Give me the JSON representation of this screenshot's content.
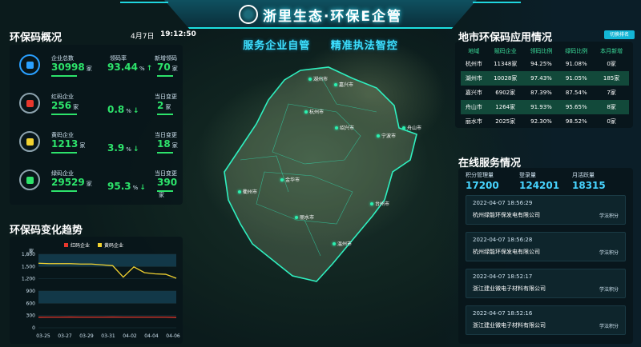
{
  "header": {
    "title": "浙里生态·环保E企管",
    "slogan_left": "服务企业自管",
    "slogan_right": "精准执法智控"
  },
  "overview": {
    "title": "环保码概况",
    "date": "4月7日",
    "time": "19:12:50",
    "rows": [
      {
        "label1": "企业总数",
        "value1": "30998",
        "unit1": "家",
        "label2": "领码率",
        "value2": "93.44",
        "unit2": "%",
        "label3": "新增领码",
        "value3": "70",
        "unit3": "家",
        "color": "#2de36b",
        "icon": "enterprise-icon"
      },
      {
        "label1": "红码企业",
        "value1": "256",
        "unit1": "家",
        "label2": "",
        "value2": "0.8",
        "unit2": "%",
        "label3": "当日变更",
        "value3": "2",
        "unit3": "家",
        "color": "#2de36b",
        "icon": "red-code-icon"
      },
      {
        "label1": "黄码企业",
        "value1": "1213",
        "unit1": "家",
        "label2": "",
        "value2": "3.9",
        "unit2": "%",
        "label3": "当日变更",
        "value3": "18",
        "unit3": "家",
        "color": "#2de36b",
        "icon": "yellow-code-icon"
      },
      {
        "label1": "绿码企业",
        "value1": "29529",
        "unit1": "家",
        "label2": "",
        "value2": "95.3",
        "unit2": "%",
        "label3": "当日变更",
        "value3": "390",
        "unit3": "家",
        "color": "#2de36b",
        "icon": "green-code-icon"
      }
    ]
  },
  "trend": {
    "title": "环保码变化趋势"
  },
  "chart_data": {
    "type": "line",
    "title": "",
    "ylabel": "家",
    "xlabel": "",
    "ylim": [
      0,
      1800
    ],
    "yticks": [
      "1,800",
      "1,500",
      "1,200",
      "900",
      "600",
      "300",
      "0"
    ],
    "x": [
      "03-25",
      "03-27",
      "03-29",
      "03-31",
      "04-02",
      "04-04",
      "04-06"
    ],
    "series": [
      {
        "name": "红码企业",
        "color": "#e8372c",
        "values": [
          260,
          262,
          262,
          263,
          262,
          262,
          262,
          263,
          262,
          262,
          262,
          262,
          262,
          256
        ]
      },
      {
        "name": "黄码企业",
        "color": "#f2d230",
        "values": [
          1580,
          1570,
          1570,
          1570,
          1560,
          1560,
          1540,
          1520,
          1240,
          1490,
          1350,
          1320,
          1310,
          1213
        ]
      }
    ],
    "x_points": 14,
    "grid": true,
    "legend": "top-left"
  },
  "cities": {
    "title": "地市环保码应用情况",
    "button": "切换排名",
    "headers": [
      "地域",
      "赋码企业",
      "领码比例",
      "绿码比例",
      "本月新增"
    ],
    "rows": [
      [
        "杭州市",
        "11348家",
        "94.25%",
        "91.08%",
        "0家"
      ],
      [
        "湖州市",
        "10028家",
        "97.43%",
        "91.05%",
        "185家"
      ],
      [
        "嘉兴市",
        "6902家",
        "87.39%",
        "87.54%",
        "7家"
      ],
      [
        "舟山市",
        "1264家",
        "91.93%",
        "95.65%",
        "8家"
      ],
      [
        "丽水市",
        "2025家",
        "92.30%",
        "98.52%",
        "0家"
      ]
    ],
    "highlight": [
      1,
      3
    ]
  },
  "service": {
    "title": "在线服务情况",
    "stats": [
      {
        "label": "积分管理量",
        "value": "17200"
      },
      {
        "label": "登录量",
        "value": "124201"
      },
      {
        "label": "月活跃量",
        "value": "18315"
      }
    ],
    "cards": [
      {
        "time": "2022-04-07 18:56:29",
        "company": "杭州绿能环保发电有限公司",
        "tag": "学法积分"
      },
      {
        "time": "2022-04-07 18:56:28",
        "company": "杭州绿能环保发电有限公司",
        "tag": "学法积分"
      },
      {
        "time": "2022-04-07 18:52:17",
        "company": "浙江建业微电子材料有限公司",
        "tag": "学法积分"
      },
      {
        "time": "2022-04-07 18:52:16",
        "company": "浙江建业微电子材料有限公司",
        "tag": "学法积分"
      }
    ]
  },
  "map": {
    "cities": [
      "湖州市",
      "嘉兴市",
      "杭州市",
      "绍兴市",
      "宁波市",
      "舟山市",
      "衢州市",
      "金华市",
      "台州市",
      "丽水市",
      "温州市"
    ]
  }
}
